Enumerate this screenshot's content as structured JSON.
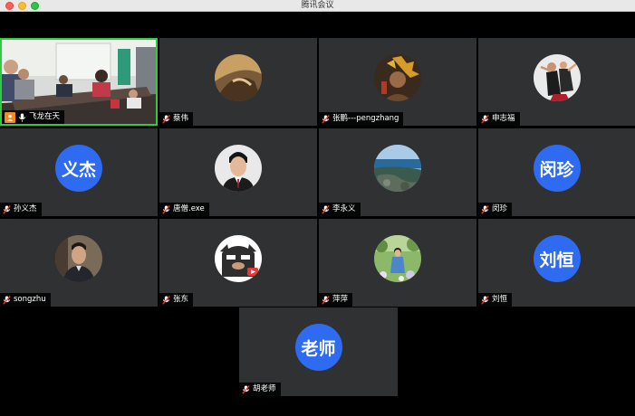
{
  "window": {
    "title": "腾讯会议"
  },
  "participants": [
    {
      "name": "飞龙在天",
      "kind": "video"
    },
    {
      "name": "蔡伟",
      "kind": "photo"
    },
    {
      "name": "张鹏---pengzhang",
      "kind": "photo"
    },
    {
      "name": "申志福",
      "kind": "photo"
    },
    {
      "name": "孙义杰",
      "kind": "initials",
      "initials": "义杰"
    },
    {
      "name": "唐僧.exe",
      "kind": "photo"
    },
    {
      "name": "李永义",
      "kind": "photo"
    },
    {
      "name": "闵珍",
      "kind": "initials",
      "initials": "闵珍"
    },
    {
      "name": "songzhu",
      "kind": "photo"
    },
    {
      "name": "张东",
      "kind": "photo"
    },
    {
      "name": "萍萍",
      "kind": "photo"
    },
    {
      "name": "刘恒",
      "kind": "initials",
      "initials": "刘恒"
    },
    {
      "name": "胡老师",
      "kind": "initials",
      "initials": "老师"
    }
  ],
  "colors": {
    "tile_bg": "#2f3133",
    "initials_bg": "#2e6bf0",
    "active_border": "#2ecc40",
    "mic_muted": "#ff3b30"
  },
  "icons": {
    "muted": "mic-muted-icon",
    "host": "host-icon",
    "mic": "microphone-icon"
  }
}
